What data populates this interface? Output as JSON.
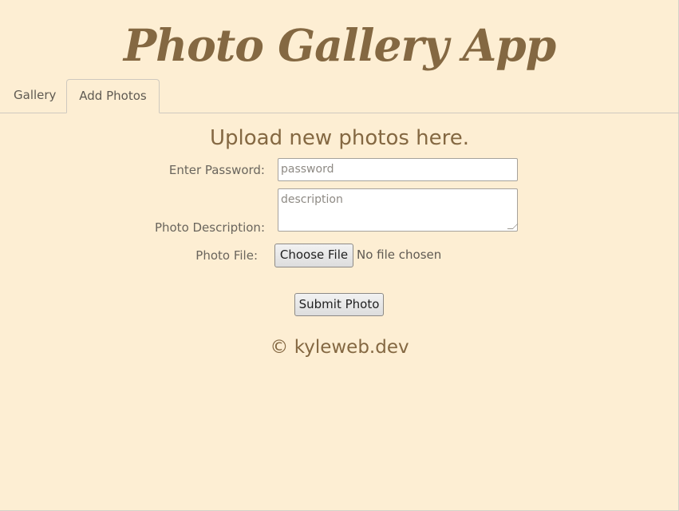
{
  "app": {
    "title": "Photo Gallery App"
  },
  "tabs": [
    {
      "label": "Gallery",
      "active": false
    },
    {
      "label": "Add Photos",
      "active": true
    }
  ],
  "upload": {
    "heading": "Upload new photos here.",
    "password_label": "Enter Password:",
    "password_placeholder": "password",
    "description_label": "Photo Description:",
    "description_placeholder": "description",
    "file_label": "Photo File:",
    "file_button": "Choose File",
    "file_status": "No file chosen",
    "submit_label": "Submit Photo"
  },
  "footer": {
    "text": "© kyleweb.dev"
  },
  "colors": {
    "background": "#fdeed3",
    "accent": "#846842"
  }
}
